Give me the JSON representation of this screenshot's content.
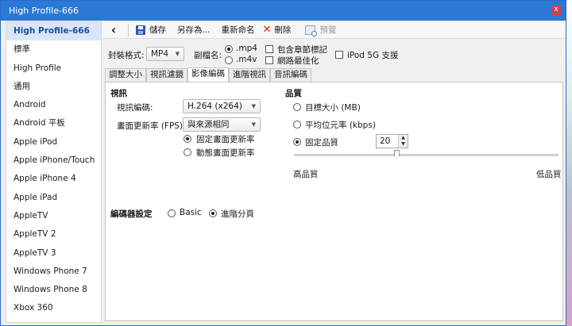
{
  "window": {
    "title": "High Profile-666"
  },
  "sidebar": {
    "items": [
      "High Profile-666",
      "標準",
      "High Profile",
      "通用",
      "Android",
      "Android 平板",
      "Apple iPod",
      "Apple iPhone/Touch",
      "Apple iPhone 4",
      "Apple iPad",
      "AppleTV",
      "AppleTV 2",
      "AppleTV 3",
      "Windows Phone 7",
      "Windows Phone 8",
      "Xbox 360"
    ],
    "selected_index": 0
  },
  "toolbar": {
    "save": "儲存",
    "save_as": "另存為...",
    "rename": "重新命名",
    "delete": "刪除",
    "preview": "預覽"
  },
  "format": {
    "container_label": "封裝格式:",
    "container_value": "MP4",
    "ext_label": "副檔名:",
    "ext_mp4": ".mp4",
    "ext_m4v": ".m4v",
    "ext_selected": ".mp4",
    "include_chapters": "包含章節標記",
    "web_optimized": "網路最佳化",
    "ipod5g": "iPod 5G 支援"
  },
  "tabs": [
    "調整大小",
    "視訊濾鏡",
    "影像編碼",
    "進階視訊",
    "音訊編碼"
  ],
  "active_tab_index": 2,
  "video": {
    "heading": "視訊",
    "codec_label": "視訊編碼:",
    "codec_value": "H.264 (x264)",
    "fps_label": "畫面更新率 (FPS):",
    "fps_value": "與來源相同",
    "cfr": "固定畫面更新率",
    "vfr": "動態畫面更新率",
    "rate_selected": "cfr"
  },
  "quality": {
    "heading": "品質",
    "target_size": "目標大小 (MB)",
    "avg_bitrate": "平均位元率 (kbps)",
    "constant_quality": "固定品質",
    "selected": "constant_quality",
    "rf_value": "20",
    "slider_fraction": 0.39,
    "high_label": "高品質",
    "low_label": "低品質"
  },
  "encoder": {
    "label": "編碼器設定",
    "basic": "Basic",
    "advanced": "進階分頁",
    "selected": "advanced"
  }
}
